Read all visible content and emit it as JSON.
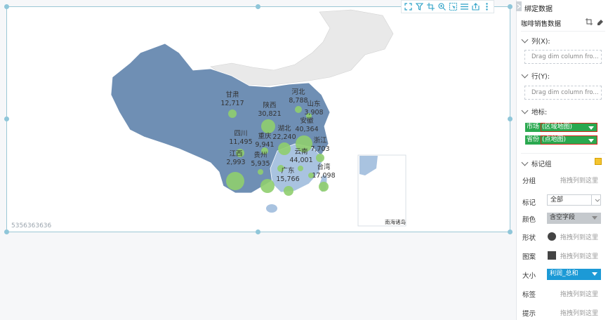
{
  "chart": {
    "id_text": "5356363636",
    "inset_label": "南海诸岛",
    "region_labels": [
      {
        "name": "甘肃",
        "value": "12,717"
      },
      {
        "name": "陕西",
        "value": "30,821"
      },
      {
        "name": "河北",
        "value": "8,788"
      },
      {
        "name": "山东",
        "value": "3,908"
      },
      {
        "name": "四川",
        "value": "11,495"
      },
      {
        "name": "湖北",
        "value": "22,240"
      },
      {
        "name": "安徽",
        "value": "40,364"
      },
      {
        "name": "重庆",
        "value": "9,941"
      },
      {
        "name": "浙江",
        "value": "7,703"
      },
      {
        "name": "云南",
        "value": "44,001"
      },
      {
        "name": "贵州",
        "value": "5,935"
      },
      {
        "name": "江西",
        "value": "2,993"
      },
      {
        "name": "广东",
        "value": "15,766"
      },
      {
        "name": "台湾",
        "value": "17,098"
      }
    ],
    "colors": {
      "region": "#6f8fb4",
      "region_light": "#a9c3e0",
      "other": "#e9e9e9",
      "bubble": "#8fce6e"
    }
  },
  "toolbar": {
    "icons": [
      "fullscreen-icon",
      "filter-icon",
      "crop-icon",
      "zoom-in-icon",
      "select-icon",
      "list-icon",
      "export-icon",
      "more-icon"
    ]
  },
  "panel": {
    "title": "绑定数据",
    "dataset": "咖啡销售数据",
    "columns_label": "列(X):",
    "rows_label": "行(Y):",
    "drop_placeholder": "Drag dim column fro...",
    "geo_label": "地标:",
    "geo_fields": [
      {
        "name": "市场",
        "type": "(区域地图)"
      },
      {
        "name": "省份",
        "type": "(点地图)"
      }
    ],
    "marks_label": "标记组",
    "group_label": "分组",
    "drag_placeholder": "拖拽列到这里",
    "mark_label": "标记",
    "mark_value": "全部",
    "color_label": "颜色",
    "color_value": "含空字段",
    "shape_label": "形状",
    "pattern_label": "图案",
    "size_label": "大小",
    "size_value": "利润_总和",
    "tag_label": "标签",
    "tooltip_label": "提示",
    "accent": "#1c9ad6",
    "green": "#2aa84f"
  }
}
